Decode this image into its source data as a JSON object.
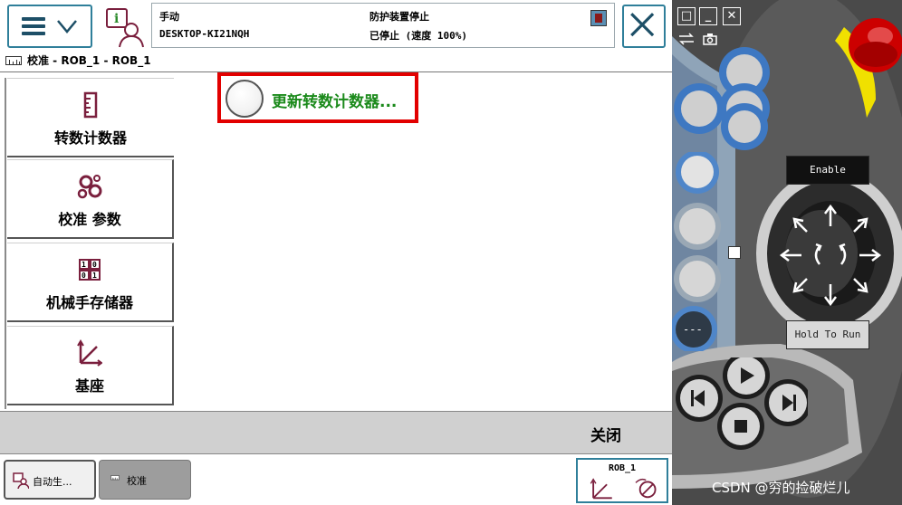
{
  "app": {
    "status": {
      "mode": "手动",
      "hostname": "DESKTOP-KI21NQH",
      "guard": "防护装置停止",
      "state": "已停止 (速度 100%)"
    },
    "window_title": "校准 - ROB_1 - ROB_1"
  },
  "nav": {
    "items": [
      {
        "label": "转数计数器",
        "icon": "revolution-counter-icon"
      },
      {
        "label": "校准 参数",
        "icon": "gears-icon"
      },
      {
        "label": "机械手存储器",
        "icon": "memory-icon"
      },
      {
        "label": "基座",
        "icon": "base-frame-icon"
      }
    ]
  },
  "content": {
    "update_button_label": "更新转数计数器..."
  },
  "bottom": {
    "close_label": "关闭"
  },
  "taskbar": {
    "auto_label": "自动生...",
    "calib_label": "校准",
    "robot_label": "ROB_1"
  },
  "pendant": {
    "enable_label": "Enable",
    "hold_label": "Hold To Run",
    "watermark": "CSDN @穷的捡破烂儿"
  },
  "colors": {
    "accent_frame": "#2f7f9a",
    "highlight_red": "#e20000",
    "update_green": "#1b8a1b",
    "icon_maroon": "#7a1f3d",
    "pendant_blue": "#3e78c2"
  }
}
